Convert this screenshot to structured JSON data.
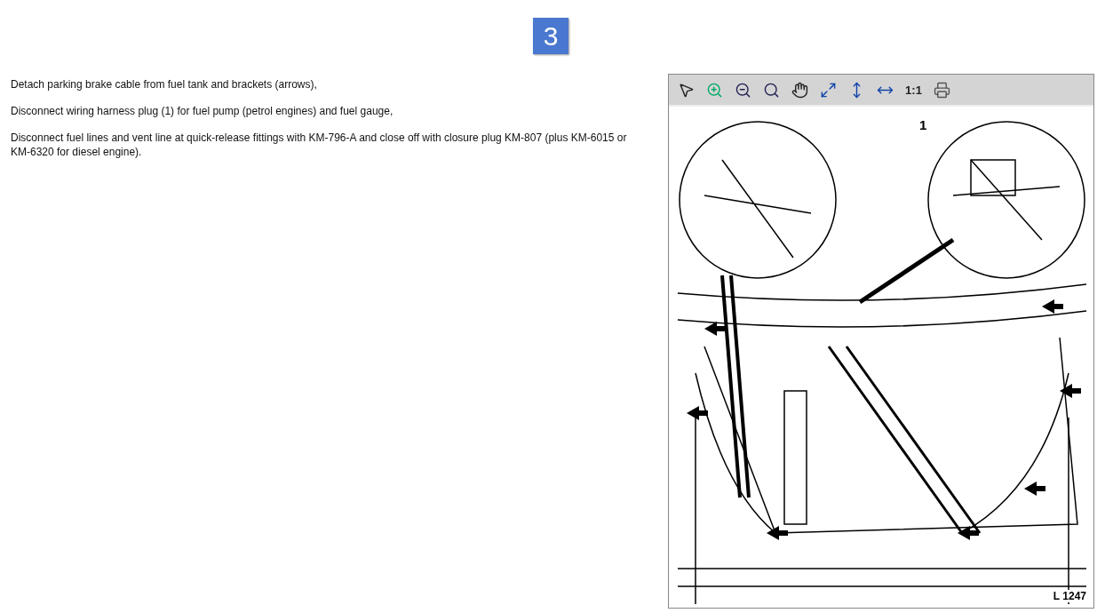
{
  "step": {
    "number": "3"
  },
  "instructions": [
    "Detach parking brake cable from fuel tank and brackets (arrows),",
    "Disconnect wiring harness plug (1) for fuel pump (petrol engines) and fuel gauge,",
    "Disconnect fuel lines and vent line at quick-release fittings with KM-796-A and close off with closure plug KM-807 (plus KM-6015 or KM-6320 for diesel engine)."
  ],
  "viewer": {
    "toolbar": [
      {
        "kind": "pointer"
      },
      {
        "kind": "zoom_in"
      },
      {
        "kind": "zoom_out"
      },
      {
        "kind": "zoom"
      },
      {
        "kind": "pan"
      },
      {
        "kind": "fit_page"
      },
      {
        "kind": "fit_height"
      },
      {
        "kind": "fit_width"
      },
      {
        "kind": "text",
        "label": "1:1"
      },
      {
        "kind": "print"
      }
    ],
    "figure": {
      "callouts": [
        "1"
      ],
      "code": "L 1247"
    }
  }
}
